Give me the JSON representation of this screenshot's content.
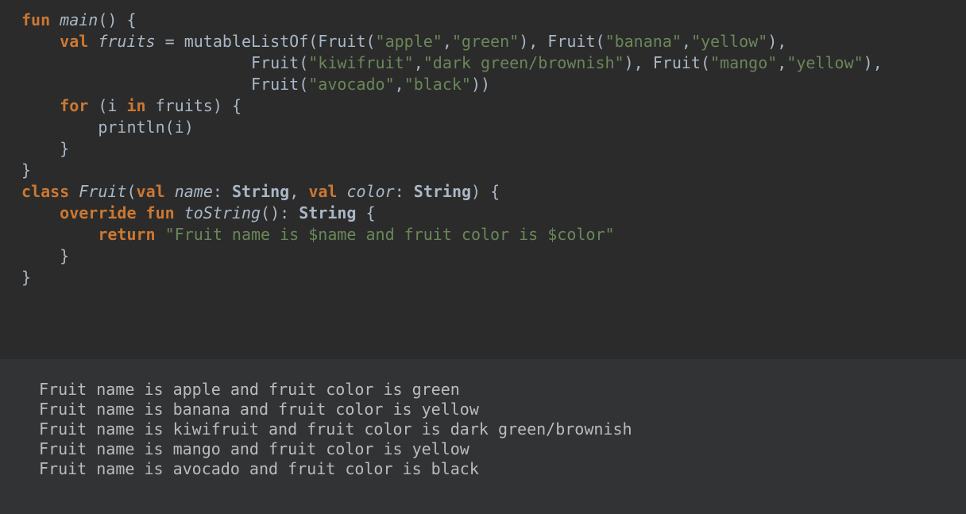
{
  "colors": {
    "editor_bg": "#2b2b2b",
    "output_bg": "#313335",
    "keyword": "#cc7832",
    "string": "#6a8759",
    "default": "#a9b7c6",
    "output_text": "#bbbbbb"
  },
  "code": {
    "lines": [
      [
        {
          "t": "keyword",
          "v": "fun"
        },
        {
          "t": "default",
          "v": " "
        },
        {
          "t": "function",
          "v": "main"
        },
        {
          "t": "default",
          "v": "() {"
        }
      ],
      [
        {
          "t": "default",
          "v": "    "
        },
        {
          "t": "keyword",
          "v": "val"
        },
        {
          "t": "default",
          "v": " "
        },
        {
          "t": "italic",
          "v": "fruits"
        },
        {
          "t": "default",
          "v": " = mutableListOf(Fruit("
        },
        {
          "t": "string",
          "v": "\"apple\""
        },
        {
          "t": "default",
          "v": ","
        },
        {
          "t": "string",
          "v": "\"green\""
        },
        {
          "t": "default",
          "v": "), Fruit("
        },
        {
          "t": "string",
          "v": "\"banana\""
        },
        {
          "t": "default",
          "v": ","
        },
        {
          "t": "string",
          "v": "\"yellow\""
        },
        {
          "t": "default",
          "v": "),"
        }
      ],
      [
        {
          "t": "default",
          "v": "                        Fruit("
        },
        {
          "t": "string",
          "v": "\"kiwifruit\""
        },
        {
          "t": "default",
          "v": ","
        },
        {
          "t": "string",
          "v": "\"dark green/brownish\""
        },
        {
          "t": "default",
          "v": "), Fruit("
        },
        {
          "t": "string",
          "v": "\"mango\""
        },
        {
          "t": "default",
          "v": ","
        },
        {
          "t": "string",
          "v": "\"yellow\""
        },
        {
          "t": "default",
          "v": "),"
        }
      ],
      [
        {
          "t": "default",
          "v": "                        Fruit("
        },
        {
          "t": "string",
          "v": "\"avocado\""
        },
        {
          "t": "default",
          "v": ","
        },
        {
          "t": "string",
          "v": "\"black\""
        },
        {
          "t": "default",
          "v": "))"
        }
      ],
      [
        {
          "t": "default",
          "v": "    "
        },
        {
          "t": "keyword",
          "v": "for"
        },
        {
          "t": "default",
          "v": " (i "
        },
        {
          "t": "keyword",
          "v": "in"
        },
        {
          "t": "default",
          "v": " fruits) {"
        }
      ],
      [
        {
          "t": "default",
          "v": "        println(i)"
        }
      ],
      [
        {
          "t": "default",
          "v": "    }"
        }
      ],
      [
        {
          "t": "default",
          "v": "}"
        }
      ],
      [
        {
          "t": "keyword",
          "v": "class"
        },
        {
          "t": "default",
          "v": " "
        },
        {
          "t": "function",
          "v": "Fruit"
        },
        {
          "t": "default",
          "v": "("
        },
        {
          "t": "keyword",
          "v": "val"
        },
        {
          "t": "default",
          "v": " "
        },
        {
          "t": "italic",
          "v": "name"
        },
        {
          "t": "default",
          "v": ": "
        },
        {
          "t": "type",
          "v": "String"
        },
        {
          "t": "default",
          "v": ", "
        },
        {
          "t": "keyword",
          "v": "val"
        },
        {
          "t": "default",
          "v": " "
        },
        {
          "t": "italic",
          "v": "color"
        },
        {
          "t": "default",
          "v": ": "
        },
        {
          "t": "type",
          "v": "String"
        },
        {
          "t": "default",
          "v": ") {"
        }
      ],
      [
        {
          "t": "default",
          "v": "    "
        },
        {
          "t": "keyword",
          "v": "override"
        },
        {
          "t": "default",
          "v": " "
        },
        {
          "t": "keyword",
          "v": "fun"
        },
        {
          "t": "default",
          "v": " "
        },
        {
          "t": "function",
          "v": "toString"
        },
        {
          "t": "default",
          "v": "(): "
        },
        {
          "t": "type",
          "v": "String"
        },
        {
          "t": "default",
          "v": " {"
        }
      ],
      [
        {
          "t": "default",
          "v": "        "
        },
        {
          "t": "keyword",
          "v": "return"
        },
        {
          "t": "default",
          "v": " "
        },
        {
          "t": "string",
          "v": "\"Fruit name is $name and fruit color is $color\""
        }
      ],
      [
        {
          "t": "default",
          "v": "    }"
        }
      ],
      [
        {
          "t": "default",
          "v": "}"
        }
      ]
    ]
  },
  "output": {
    "lines": [
      "Fruit name is apple and fruit color is green",
      "Fruit name is banana and fruit color is yellow",
      "Fruit name is kiwifruit and fruit color is dark green/brownish",
      "Fruit name is mango and fruit color is yellow",
      "Fruit name is avocado and fruit color is black"
    ]
  }
}
